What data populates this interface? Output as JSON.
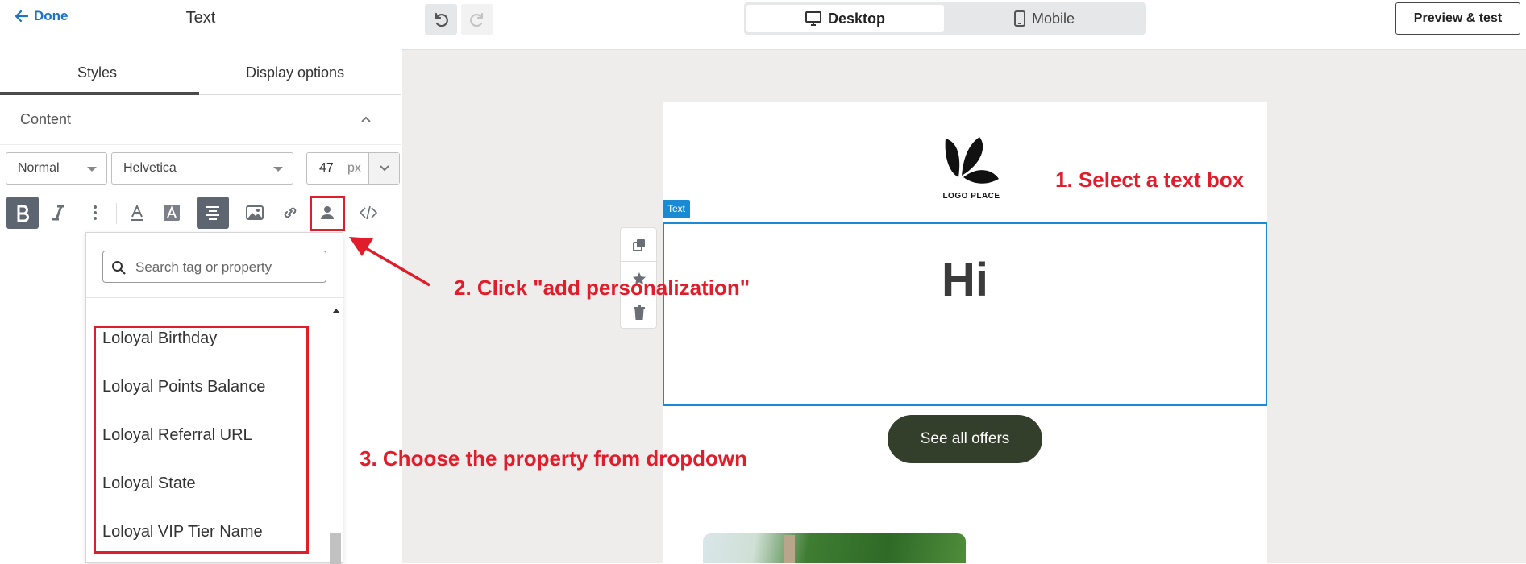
{
  "left_panel": {
    "done_label": "Done",
    "title": "Text",
    "tabs": [
      {
        "label": "Styles",
        "active": true
      },
      {
        "label": "Display options",
        "active": false
      }
    ],
    "section_label": "Content",
    "style_select": "Normal",
    "font_select": "Helvetica",
    "font_size": "47",
    "font_unit": "px",
    "toolbar_icons": [
      "bold-icon",
      "italic-icon",
      "more-vertical-icon",
      "text-color-icon",
      "highlight-color-icon",
      "align-center-icon",
      "image-icon",
      "link-icon",
      "person-icon",
      "code-icon"
    ]
  },
  "dropdown": {
    "search_placeholder": "Search tag or property",
    "items": [
      "Loloyal Birthday",
      "Loloyal Points Balance",
      "Loloyal Referral URL",
      "Loloyal State",
      "Loloyal VIP Tier Name"
    ]
  },
  "topbar": {
    "view_desktop": "Desktop",
    "view_mobile": "Mobile",
    "preview_label": "Preview & test"
  },
  "email": {
    "logo_text": "LOGO PLACE",
    "block_tag": "Text",
    "headline": "Hi",
    "cta_label": "See all offers"
  },
  "annotations": {
    "step1": "1. Select a text box",
    "step2": "2. Click \"add personalization\"",
    "step3": "3. Choose the property from dropdown",
    "color": "#e01e2b"
  },
  "colors": {
    "accent": "#1a73c7",
    "selection_blue": "#1a8ad4",
    "button_dark_green": "#333f2b",
    "canvas_bg": "#eeedec"
  }
}
